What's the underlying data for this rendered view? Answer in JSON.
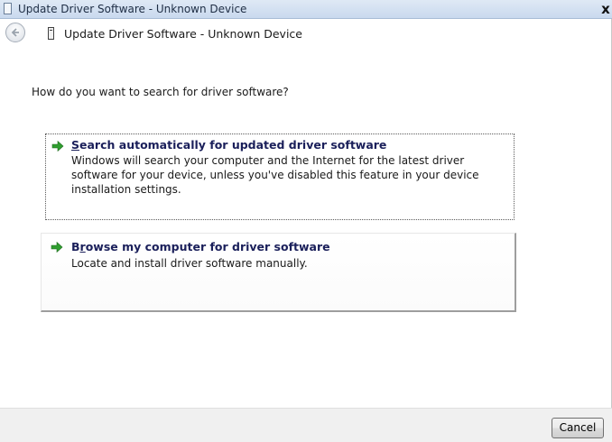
{
  "window": {
    "title": "Update Driver Software - Unknown Device",
    "close_glyph": "x"
  },
  "nav": {
    "back_icon": "back-arrow-icon",
    "title": "Update Driver Software - Unknown Device"
  },
  "main": {
    "question": "How do you want to search for driver software?",
    "options": [
      {
        "title_accel": "S",
        "title_rest": "earch automatically for updated driver software",
        "description": "Windows will search your computer and the Internet for the latest driver software for your device, unless you've disabled this feature in your device installation settings.",
        "icon": "green-arrow-icon",
        "focused": true
      },
      {
        "title_first": "B",
        "title_accel": "r",
        "title_rest": "owse my computer for driver software",
        "description": "Locate and install driver software manually.",
        "icon": "green-arrow-icon",
        "focused": false
      }
    ]
  },
  "footer": {
    "cancel_label": "Cancel"
  },
  "colors": {
    "option_title": "#1a1f5a",
    "arrow_green": "#2f9e2f"
  }
}
